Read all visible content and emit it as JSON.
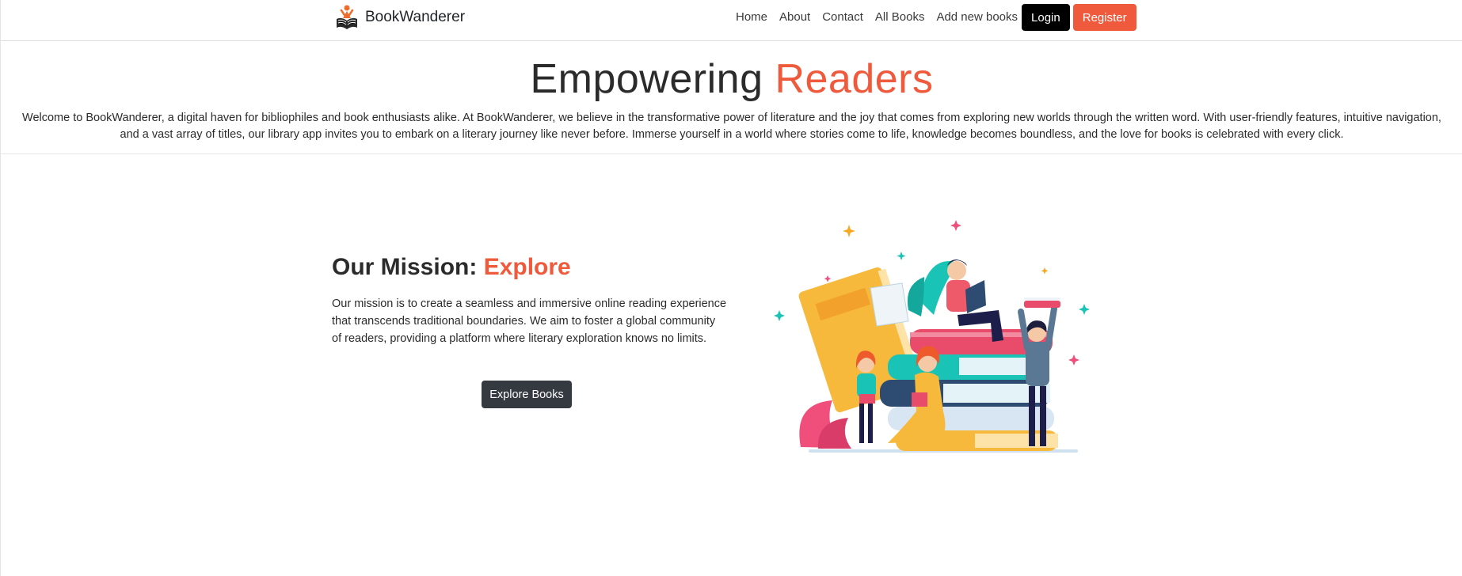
{
  "brand": {
    "name": "BookWanderer"
  },
  "nav": {
    "links": [
      "Home",
      "About",
      "Contact",
      "All Books",
      "Add new books"
    ],
    "login_label": "Login",
    "register_label": "Register"
  },
  "hero": {
    "title_main": "Empowering",
    "title_accent": "Readers",
    "description": "Welcome to BookWanderer, a digital haven for bibliophiles and book enthusiasts alike. At BookWanderer, we believe in the transformative power of literature and the joy that comes from exploring new worlds through the written word. With user-friendly features, intuitive navigation, and a vast array of titles, our library app invites you to embark on a literary journey like never before. Immerse yourself in a world where stories come to life, knowledge becomes boundless, and the love for books is celebrated with every click."
  },
  "mission": {
    "title_main": "Our Mission:",
    "title_accent": "Explore",
    "text": "Our mission is to create a seamless and immersive online reading experience that transcends traditional boundaries. We aim to foster a global community of readers, providing a platform where literary exploration knows no limits.",
    "button_label": "Explore Books"
  },
  "colors": {
    "accent": "#ef5a3c",
    "login_bg": "#000000",
    "explore_bg": "#343a40"
  },
  "icons": {
    "brand_logo": "reader-logo-icon",
    "illustration": "readers-with-books-illustration"
  }
}
